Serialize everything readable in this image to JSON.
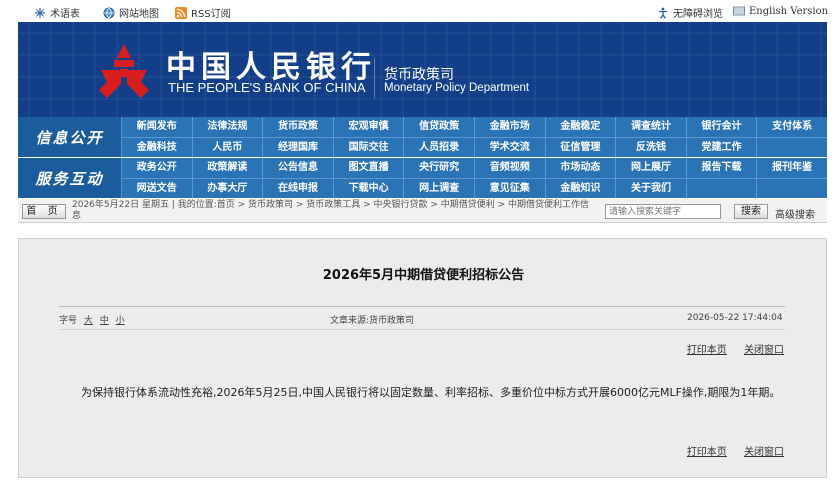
{
  "topbar": {
    "left_items": [
      {
        "label": "术语表",
        "icon": "book-icon"
      },
      {
        "label": "网站地图",
        "icon": "globe-icon"
      },
      {
        "label": "RSS订阅",
        "icon": "rss-icon"
      }
    ],
    "accessibility": "无障碍浏览",
    "english": "English Version"
  },
  "banner": {
    "bank_name_cn": "中国人民银行",
    "bank_name_en": "THE PEOPLE'S BANK OF CHINA",
    "dept_cn": "货币政策司",
    "dept_en": "Monetary Policy Department"
  },
  "nav": {
    "section1_label": "信息公开",
    "section2_label": "服务互动",
    "row1": [
      "新闻发布",
      "法律法规",
      "货币政策",
      "宏观审慎",
      "信贷政策",
      "金融市场",
      "金融稳定",
      "调查统计",
      "银行会计",
      "支付体系"
    ],
    "row2": [
      "金融科技",
      "人民币",
      "经理国库",
      "国际交往",
      "人员招录",
      "学术交流",
      "征信管理",
      "反洗钱",
      "党建工作",
      ""
    ],
    "row3": [
      "政务公开",
      "政策解读",
      "公告信息",
      "图文直播",
      "央行研究",
      "音频视频",
      "市场动态",
      "网上展厅",
      "报告下载",
      "报刊年鉴"
    ],
    "row4": [
      "网送文告",
      "办事大厅",
      "在线申报",
      "下载中心",
      "网上调查",
      "意见征集",
      "金融知识",
      "关于我们",
      "",
      ""
    ]
  },
  "crumb": {
    "home": "首 页",
    "text": "2026年5月22日 星期五 | 我的位置:首页 > 货币政策司 > 货币政策工具 > 中央银行贷款 > 中期借贷便利 > 中期借贷便利工作信息",
    "search_placeholder": "请输入搜索关键字",
    "search_button": "搜索",
    "advanced": "高级搜索"
  },
  "article": {
    "title": "2026年5月中期借贷便利招标公告",
    "font_label": "字号",
    "font_sizes": [
      "大",
      "中",
      "小"
    ],
    "source": "文章来源:货币政策司",
    "datetime": "2026-05-22 17:44:04",
    "print": "打印本页",
    "close": "关闭窗口",
    "body": "为保持银行体系流动性充裕,2026年5月25日,中国人民银行将以固定数量、利率招标、多重价位中标方式开展6000亿元MLF操作,期限为1年期。"
  }
}
